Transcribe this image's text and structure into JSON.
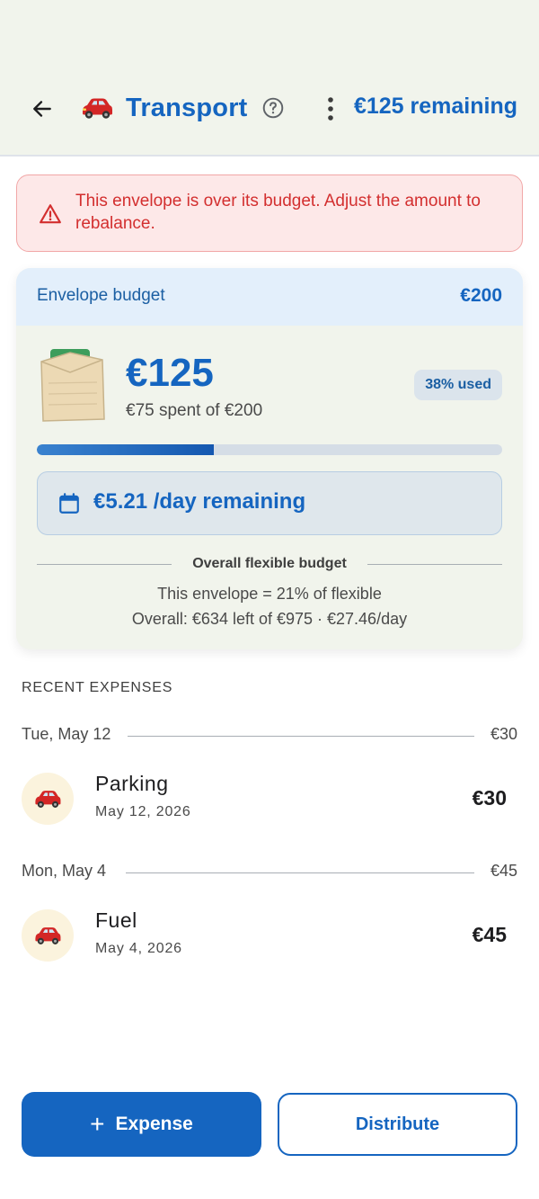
{
  "header": {
    "back_icon": "arrow-left-icon",
    "category_icon": "red-car-emoji",
    "title": "Transport",
    "help_icon": "question-circle-icon",
    "more_icon": "more-vertical-icon",
    "remaining": "€125 remaining"
  },
  "alert": {
    "icon": "warning-triangle-icon",
    "message": "This envelope is over its budget. Adjust the amount to rebalance."
  },
  "envelope": {
    "header_label": "Envelope budget",
    "header_value": "€200",
    "amount": "€125",
    "spent_text": "€75 spent of €200",
    "used_badge": "38% used",
    "progress_fraction": 0.38,
    "per_day": "€5.21 /day remaining",
    "overall_label": "Overall flexible budget",
    "share_text": "This envelope = 21% of flexible",
    "overall_text": "Overall: €634 left of €975 · €27.46/day"
  },
  "recent": {
    "title": "RECENT EXPENSES",
    "groups": [
      {
        "day": "Tue, May 12",
        "total": "€30",
        "items": [
          {
            "name": "Parking",
            "date": "May 12, 2026",
            "amount": "€30",
            "icon": "red-car-emoji"
          }
        ]
      },
      {
        "day": "Mon, May 4",
        "total": "€45",
        "items": [
          {
            "name": "Fuel",
            "date": "May 4, 2026",
            "amount": "€45",
            "icon": "red-car-emoji"
          }
        ]
      }
    ]
  },
  "actions": {
    "expense_label": "Expense",
    "distribute_label": "Distribute"
  },
  "colors": {
    "accent": "#1565c0",
    "alert_text": "#d32f2f",
    "alert_bg": "#fde8e8"
  }
}
